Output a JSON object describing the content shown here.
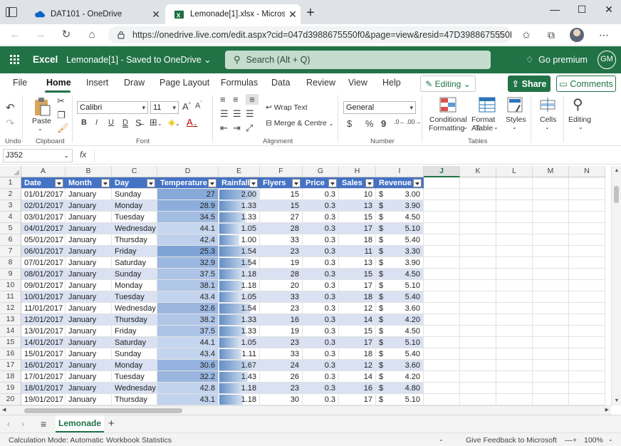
{
  "browser": {
    "tabs": [
      {
        "title": "DAT101 - OneDrive",
        "active": false
      },
      {
        "title": "Lemonade[1].xlsx - Microsoft Exc",
        "active": true
      }
    ],
    "url": "https://onedrive.live.com/edit.aspx?cid=047d3988675550f0&page=view&resid=47D3988675550F..."
  },
  "excel": {
    "app_name": "Excel",
    "doc_title": "Lemonade[1]  -  Saved to OneDrive ⌄",
    "search_placeholder": "Search (Alt + Q)",
    "premium": "Go premium",
    "user_initials": "GM",
    "accent": "#217346"
  },
  "ribbon_tabs": [
    "File",
    "Home",
    "Insert",
    "Draw",
    "Page Layout",
    "Formulas",
    "Data",
    "Review",
    "View",
    "Help"
  ],
  "ribbon_actions": {
    "editing": "Editing",
    "share": "Share",
    "comments": "Comments"
  },
  "ribbon": {
    "undo_label": "Undo",
    "clipboard": {
      "paste": "Paste",
      "group": "Clipboard"
    },
    "font": {
      "name": "Calibri",
      "size": "11",
      "group": "Font",
      "bold": "B",
      "italic": "I",
      "underline": "U",
      "double_underline": "D"
    },
    "alignment": {
      "wrap": "Wrap Text",
      "merge": "Merge & Centre",
      "group": "Alignment"
    },
    "number": {
      "format": "General",
      "currency": "$",
      "percent": "%",
      "comma": "9",
      "group": "Number"
    },
    "tables": {
      "conditional": "Conditional",
      "conditional2": "Formatting",
      "format_as": "Format As",
      "format_as2": "Table",
      "styles": "Styles",
      "group": "Tables"
    },
    "cells": "Cells",
    "editing": "Editing"
  },
  "formula_bar": {
    "name_box": "J352",
    "fx": "fx",
    "value": ""
  },
  "columns": [
    "A",
    "B",
    "C",
    "D",
    "E",
    "F",
    "G",
    "H",
    "I",
    "J",
    "K",
    "L",
    "M",
    "N"
  ],
  "table": {
    "headers": [
      "Date",
      "Month",
      "Day",
      "Temperature",
      "Rainfall",
      "Flyers",
      "Price",
      "Sales",
      "Revenue"
    ],
    "rows": [
      [
        "01/01/2017",
        "January",
        "Sunday",
        "27",
        "2.00",
        "15",
        "0.3",
        "10",
        "3.00"
      ],
      [
        "02/01/2017",
        "January",
        "Monday",
        "28.9",
        "1.33",
        "15",
        "0.3",
        "13",
        "3.90"
      ],
      [
        "03/01/2017",
        "January",
        "Tuesday",
        "34.5",
        "1.33",
        "27",
        "0.3",
        "15",
        "4.50"
      ],
      [
        "04/01/2017",
        "January",
        "Wednesday",
        "44.1",
        "1.05",
        "28",
        "0.3",
        "17",
        "5.10"
      ],
      [
        "05/01/2017",
        "January",
        "Thursday",
        "42.4",
        "1.00",
        "33",
        "0.3",
        "18",
        "5.40"
      ],
      [
        "06/01/2017",
        "January",
        "Friday",
        "25.3",
        "1.54",
        "23",
        "0.3",
        "11",
        "3.30"
      ],
      [
        "07/01/2017",
        "January",
        "Saturday",
        "32.9",
        "1.54",
        "19",
        "0.3",
        "13",
        "3.90"
      ],
      [
        "08/01/2017",
        "January",
        "Sunday",
        "37.5",
        "1.18",
        "28",
        "0.3",
        "15",
        "4.50"
      ],
      [
        "09/01/2017",
        "January",
        "Monday",
        "38.1",
        "1.18",
        "20",
        "0.3",
        "17",
        "5.10"
      ],
      [
        "10/01/2017",
        "January",
        "Tuesday",
        "43.4",
        "1.05",
        "33",
        "0.3",
        "18",
        "5.40"
      ],
      [
        "11/01/2017",
        "January",
        "Wednesday",
        "32.6",
        "1.54",
        "23",
        "0.3",
        "12",
        "3.60"
      ],
      [
        "12/01/2017",
        "January",
        "Thursday",
        "38.2",
        "1.33",
        "16",
        "0.3",
        "14",
        "4.20"
      ],
      [
        "13/01/2017",
        "January",
        "Friday",
        "37.5",
        "1.33",
        "19",
        "0.3",
        "15",
        "4.50"
      ],
      [
        "14/01/2017",
        "January",
        "Saturday",
        "44.1",
        "1.05",
        "23",
        "0.3",
        "17",
        "5.10"
      ],
      [
        "15/01/2017",
        "January",
        "Sunday",
        "43.4",
        "1.11",
        "33",
        "0.3",
        "18",
        "5.40"
      ],
      [
        "16/01/2017",
        "January",
        "Monday",
        "30.6",
        "1.67",
        "24",
        "0.3",
        "12",
        "3.60"
      ],
      [
        "17/01/2017",
        "January",
        "Tuesday",
        "32.2",
        "1.43",
        "26",
        "0.3",
        "14",
        "4.20"
      ],
      [
        "18/01/2017",
        "January",
        "Wednesday",
        "42.8",
        "1.18",
        "23",
        "0.3",
        "16",
        "4.80"
      ],
      [
        "19/01/2017",
        "January",
        "Thursday",
        "43.1",
        "1.18",
        "30",
        "0.3",
        "17",
        "5.10"
      ]
    ],
    "currency_symbol": "$",
    "header_color": "#4472c4",
    "band_color": "#d9e1f2"
  },
  "sheet_tabs": [
    "Lemonade"
  ],
  "status": {
    "calc_mode": "Calculation Mode: Automatic",
    "workbook_stats": "Workbook Statistics",
    "feedback": "Give Feedback to Microsoft",
    "zoom": "100%",
    "zoom_minus": "—",
    "zoom_plus": "+"
  }
}
